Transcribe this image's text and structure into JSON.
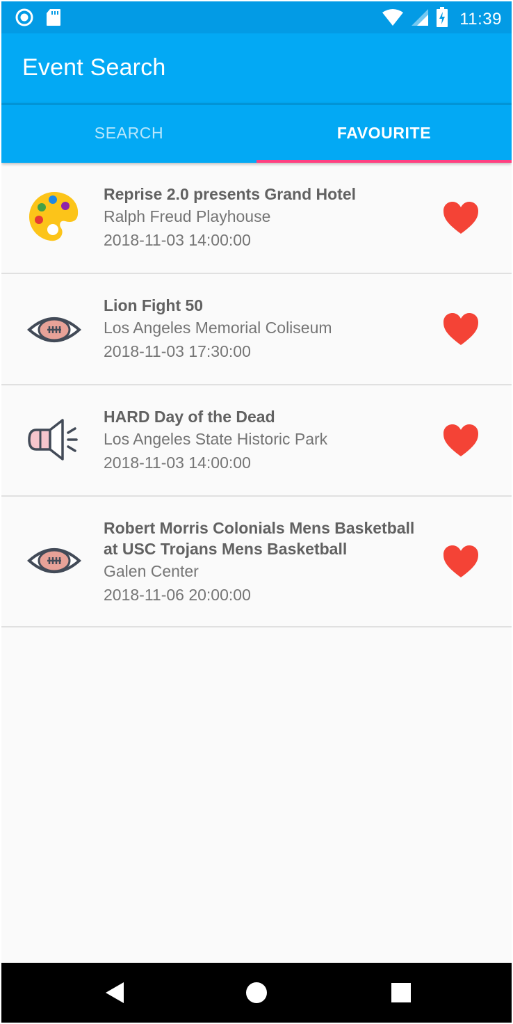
{
  "status_bar": {
    "time": "11:39",
    "left_icons": [
      "notification-circle-icon",
      "sd-card-icon"
    ],
    "right_icons": [
      "wifi-icon",
      "cell-signal-icon",
      "battery-charging-icon"
    ]
  },
  "app_bar": {
    "title": "Event Search"
  },
  "tabs": [
    {
      "label": "SEARCH",
      "active": false
    },
    {
      "label": "FAVOURITE",
      "active": true
    }
  ],
  "favourites": [
    {
      "icon": "palette-icon",
      "title": "Reprise 2.0 presents Grand Hotel",
      "venue": "Ralph Freud Playhouse",
      "date": "2018-11-03 14:00:00",
      "favourited": true
    },
    {
      "icon": "football-icon",
      "title": "Lion Fight 50",
      "venue": "Los Angeles Memorial Coliseum",
      "date": "2018-11-03 17:30:00",
      "favourited": true
    },
    {
      "icon": "megaphone-icon",
      "title": "HARD Day of the Dead",
      "venue": "Los Angeles State Historic Park",
      "date": "2018-11-03 14:00:00",
      "favourited": true
    },
    {
      "icon": "football-icon",
      "title": "Robert Morris Colonials Mens Basketball at USC Trojans Mens Basketball",
      "venue": "Galen Center",
      "date": "2018-11-06 20:00:00",
      "favourited": true
    }
  ],
  "colors": {
    "primary": "#03a9f4",
    "primary_dark": "#039be5",
    "accent": "#ff4081",
    "heart": "#f44336"
  },
  "nav_bar": [
    "back-icon",
    "home-icon",
    "recents-icon"
  ]
}
